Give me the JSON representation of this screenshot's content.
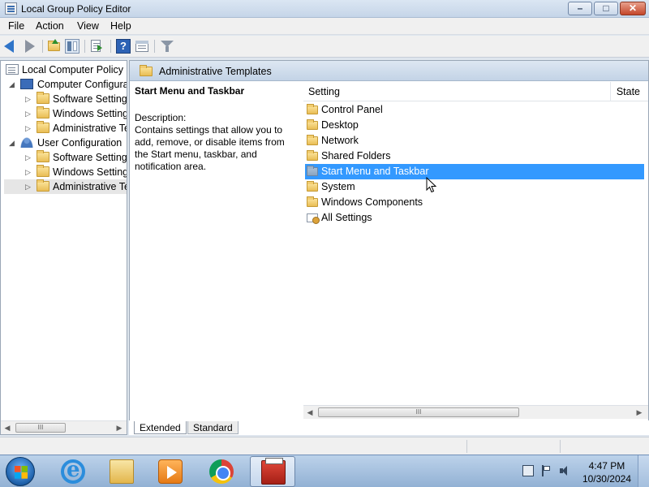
{
  "window": {
    "title": "Local Group Policy Editor",
    "controls": {
      "minimize": "–",
      "maximize": "□",
      "close": "✕"
    }
  },
  "menubar": {
    "items": [
      "File",
      "Action",
      "View",
      "Help"
    ]
  },
  "toolbar": {
    "buttons": [
      "back-icon",
      "forward-icon",
      "up-folder-icon",
      "show-hide-tree-icon",
      "export-list-icon",
      "help-icon",
      "properties-icon",
      "filter-icon"
    ]
  },
  "tree": {
    "items": [
      {
        "label": "Local Computer Policy",
        "icon": "policy-doc-icon",
        "level": 0,
        "twisty": ""
      },
      {
        "label": "Computer Configuration",
        "icon": "computer-icon",
        "level": 1,
        "twisty": "◢"
      },
      {
        "label": "Software Settings",
        "icon": "folder-icon",
        "level": 2,
        "twisty": "▷"
      },
      {
        "label": "Windows Settings",
        "icon": "folder-icon",
        "level": 2,
        "twisty": "▷"
      },
      {
        "label": "Administrative Templates",
        "icon": "folder-icon",
        "level": 2,
        "twisty": "▷"
      },
      {
        "label": "User Configuration",
        "icon": "user-icon",
        "level": 1,
        "twisty": "◢"
      },
      {
        "label": "Software Settings",
        "icon": "folder-icon",
        "level": 2,
        "twisty": "▷"
      },
      {
        "label": "Windows Settings",
        "icon": "folder-icon",
        "level": 2,
        "twisty": "▷"
      },
      {
        "label": "Administrative Templates",
        "icon": "folder-icon",
        "level": 2,
        "twisty": "▷",
        "selected": true
      }
    ],
    "scroll_thumb": "III"
  },
  "breadcrumb": {
    "label": "Administrative Templates"
  },
  "description": {
    "title": "Start Menu and Taskbar",
    "label": "Description:",
    "text": "Contains settings that allow you to add, remove, or disable items from the Start menu, taskbar, and notification area."
  },
  "list": {
    "columns": {
      "setting": "Setting",
      "state": "State"
    },
    "items": [
      {
        "label": "Control Panel",
        "icon": "folder-icon"
      },
      {
        "label": "Desktop",
        "icon": "folder-icon"
      },
      {
        "label": "Network",
        "icon": "folder-icon"
      },
      {
        "label": "Shared Folders",
        "icon": "folder-icon"
      },
      {
        "label": "Start Menu and Taskbar",
        "icon": "folder-icon",
        "selected": true
      },
      {
        "label": "System",
        "icon": "folder-icon"
      },
      {
        "label": "Windows Components",
        "icon": "folder-icon"
      },
      {
        "label": "All Settings",
        "icon": "all-settings-icon"
      }
    ],
    "scroll_thumb": "III"
  },
  "tabs": {
    "extended": "Extended",
    "standard": "Standard"
  },
  "taskbar": {
    "apps": [
      "internet-explorer-icon",
      "windows-explorer-icon",
      "media-player-icon",
      "chrome-icon",
      "group-policy-editor-icon"
    ],
    "clock": {
      "time": "4:47 PM",
      "date": "10/30/2024"
    }
  },
  "colors": {
    "selection": "#3399ff",
    "titlebar": "#c5d5e8",
    "taskbar": "#92b1d4"
  }
}
